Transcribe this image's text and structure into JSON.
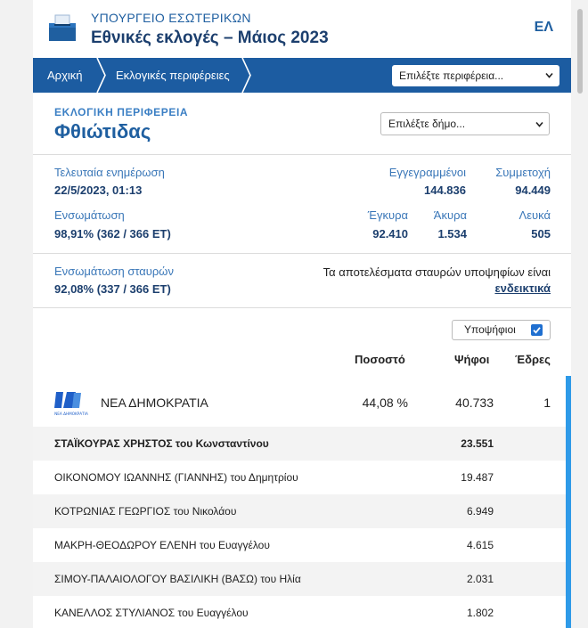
{
  "header": {
    "ministry": "ΥΠΟΥΡΓΕΙΟ ΕΣΩΤΕΡΙΚΩΝ",
    "title": "Εθνικές εκλογές – Μάιος 2023",
    "lang": "ΕΛ"
  },
  "breadcrumb": {
    "home": "Αρχική",
    "regions": "Εκλογικές περιφέρειες",
    "region_select_placeholder": "Επιλέξτε περιφέρεια..."
  },
  "region": {
    "label": "ΕΚΛΟΓΙΚΗ ΠΕΡΙΦΕΡΕΙΑ",
    "name": "Φθιώτιδας",
    "municipality_select_placeholder": "Επιλέξτε δήμο..."
  },
  "stats": {
    "last_update_label": "Τελευταία ενημέρωση",
    "last_update_value": "22/5/2023, 01:13",
    "registered_label": "Εγγεγραμμένοι",
    "registered_value": "144.836",
    "turnout_label": "Συμμετοχή",
    "turnout_value": "94.449",
    "integration_label": "Ενσωμάτωση",
    "integration_value": "98,91% (362 / 366 ΕΤ)",
    "valid_label": "Έγκυρα",
    "valid_value": "92.410",
    "invalid_label": "Άκυρα",
    "invalid_value": "1.534",
    "blank_label": "Λευκά",
    "blank_value": "505",
    "cross_integration_label": "Ενσωμάτωση σταυρών",
    "cross_integration_value": "92,08% (337 / 366 ΕΤ)",
    "note_text": "Τα αποτελέσματα σταυρών υποψηφίων είναι",
    "note_link": "ενδεικτικά"
  },
  "results": {
    "candidates_toggle": "Υποψήφιοι",
    "candidates_checked": true,
    "col_percent": "Ποσοστό",
    "col_votes": "Ψήφοι",
    "col_seats": "Έδρες",
    "party": {
      "name": "ΝΕΑ ΔΗΜΟΚΡΑΤΙΑ",
      "logo_text": "ΝΔ",
      "logo_caption": "ΝΕΑ ΔΗΜΟΚΡΑΤΙΑ",
      "percent": "44,08 %",
      "votes": "40.733",
      "seats": "1",
      "color": "#1f5fc8"
    },
    "candidates": [
      {
        "name": "ΣΤΑΪΚΟΥΡΑΣ ΧΡΗΣΤΟΣ του Κωνσταντίνου",
        "votes": "23.551"
      },
      {
        "name": "ΟΙΚΟΝΟΜΟΥ ΙΩΑΝΝΗΣ (ΓΙΑΝΝΗΣ) του Δημητρίου",
        "votes": "19.487"
      },
      {
        "name": "ΚΟΤΡΩΝΙΑΣ ΓΕΩΡΓΙΟΣ του Νικολάου",
        "votes": "6.949"
      },
      {
        "name": "ΜΑΚΡΗ-ΘΕΟΔΩΡΟΥ ΕΛΕΝΗ του Ευαγγέλου",
        "votes": "4.615"
      },
      {
        "name": "ΣΙΜΟΥ-ΠΑΛΑΙΟΛΟΓΟΥ ΒΑΣΙΛΙΚΗ (ΒΑΣΩ) του Ηλία",
        "votes": "2.031"
      },
      {
        "name": "ΚΑΝΕΛΛΟΣ ΣΤΥΛΙΑΝΟΣ του Ευαγγέλου",
        "votes": "1.802"
      }
    ]
  },
  "colors": {
    "primary": "#1c5ca1",
    "accent": "#3b7fc4",
    "scroll_accent": "#2e9ae8"
  }
}
